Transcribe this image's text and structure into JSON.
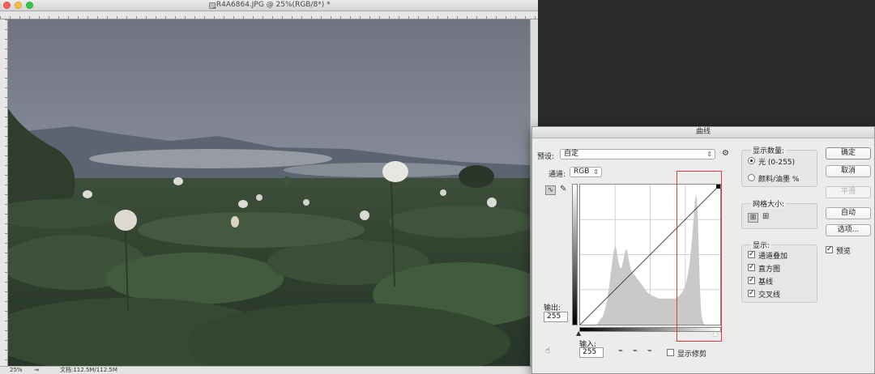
{
  "document": {
    "title": "_R4A6864.JPG @ 25%(RGB/8*) *",
    "zoom": "25%",
    "doc_size": "文档:112.5M/112.5M",
    "arrow": "⇥"
  },
  "dialog": {
    "title": "曲线",
    "preset_label": "预设:",
    "preset_value": "自定",
    "channel_label": "通道:",
    "channel_value": "RGB",
    "output_label": "输出:",
    "output_value": "255",
    "input_label": "输入:",
    "input_value": "255",
    "show_clipping_label": "显示修剪",
    "show_clipping_checked": false,
    "buttons": {
      "ok": "确定",
      "cancel": "取消",
      "smooth": "平滑",
      "auto": "自动",
      "options": "选项..."
    },
    "preview_label": "预览",
    "preview_checked": true,
    "show_amount": {
      "title": "显示数量:",
      "light": "光 (0-255)",
      "pigment": "颜料/油墨 %",
      "selected": "light"
    },
    "grid_size": {
      "title": "网格大小:"
    },
    "show": {
      "title": "显示:",
      "items": [
        {
          "label": "通道叠加",
          "checked": true
        },
        {
          "label": "直方图",
          "checked": true
        },
        {
          "label": "基线",
          "checked": true
        },
        {
          "label": "交叉线",
          "checked": true
        }
      ]
    },
    "histogram": [
      0,
      0,
      0,
      0,
      0,
      0,
      0,
      0,
      0,
      0,
      0,
      0,
      0,
      0,
      0,
      0,
      0,
      0,
      1,
      2,
      3,
      4,
      5,
      6,
      8,
      10,
      13,
      16,
      20,
      25,
      30,
      36,
      42,
      48,
      54,
      58,
      60,
      59,
      55,
      50,
      46,
      44,
      43,
      45,
      48,
      52,
      56,
      58,
      57,
      54,
      50,
      46,
      43,
      41,
      40,
      39,
      38,
      37,
      36,
      35,
      34,
      33,
      32,
      31,
      30,
      29,
      28,
      27,
      26,
      25,
      24,
      24,
      23,
      23,
      22,
      22,
      22,
      21,
      21,
      21,
      20,
      20,
      20,
      20,
      20,
      20,
      20,
      20,
      20,
      20,
      20,
      20,
      20,
      20,
      20,
      20,
      20,
      20,
      20,
      21,
      21,
      22,
      22,
      23,
      24,
      25,
      26,
      28,
      30,
      33,
      36,
      40,
      45,
      51,
      58,
      66,
      75,
      85,
      95,
      100,
      97,
      80,
      55,
      30,
      14,
      6,
      3,
      1,
      0,
      0,
      0,
      0,
      0,
      0,
      0,
      0,
      0,
      0,
      0,
      0,
      0,
      0,
      0,
      0,
      0
    ],
    "colors": {
      "highlight_box": "#e8383a",
      "histogram": "#c9c9c9"
    }
  }
}
